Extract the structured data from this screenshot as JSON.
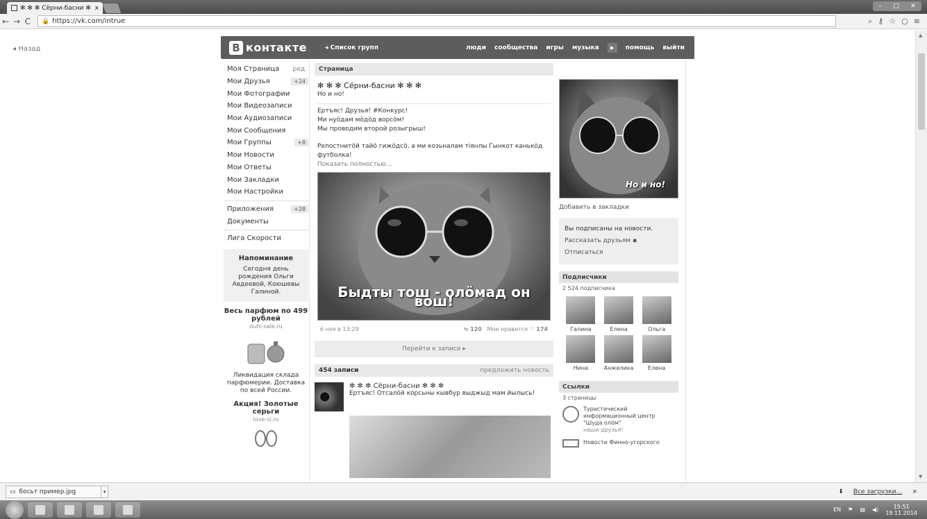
{
  "browser": {
    "tab_title": "✻ ✻ ✻ Сёрни-басни ✻",
    "tab_close": "x",
    "url": "https://vk.com/intrue"
  },
  "page": {
    "back": "Назад"
  },
  "vk": {
    "logo_letter": "В",
    "logo_text": "контакте",
    "group_list": "Список групп",
    "nav": [
      "люди",
      "сообщества",
      "игры",
      "музыка",
      "помощь",
      "выйти"
    ]
  },
  "menu": {
    "items": [
      {
        "label": "Моя Страница",
        "extra": "ред."
      },
      {
        "label": "Мои Друзья",
        "badge": "+24"
      },
      {
        "label": "Мои Фотографии"
      },
      {
        "label": "Мои Видеозаписи"
      },
      {
        "label": "Мои Аудиозаписи"
      },
      {
        "label": "Мои Сообщения"
      },
      {
        "label": "Мои Группы",
        "badge": "+8"
      },
      {
        "label": "Мои Новости"
      },
      {
        "label": "Мои Ответы"
      },
      {
        "label": "Мои Закладки"
      },
      {
        "label": "Мои Настройки"
      }
    ],
    "apps": {
      "label": "Приложения",
      "badge": "+28"
    },
    "docs": "Документы",
    "league": "Лига Скорости",
    "reminder_title": "Напоминание",
    "reminder_text": "Сегодня день рождения Ольги Авдеевой, Коюшевы Галиной.",
    "ad1_title": "Весь парфюм по 499 рублей",
    "ad1_url": "duhi-sale.ru",
    "ad1_text": "Ликвидация склада парфюмерии. Доставка по всей России.",
    "ad2_title": "Акция! Золотые серьги",
    "ad2_url": "love-sl.ru"
  },
  "main": {
    "page_bar": "Страница",
    "group_name": "✻ ✻ ✻ Сёрни-басни ✻ ✻ ✻",
    "status": "Но и но!",
    "post_lines": [
      "Ертъяс! Друзья! #Конкурс!",
      "Ми нуӧдам мӧдӧд ворсӧм!",
      "Мы проводим второй розыгрыш!",
      "Репостнитӧй тайӧ гижӧдсӧ, а ми козьналам тiянлы Гынкот канькӧд футболка!"
    ],
    "show_more": "Показать полностью…",
    "photo_caption": "Быдты тош - олӧмад он вош!",
    "date": "6 ноя в 13:29",
    "reposts": "120",
    "likes_label": "Мне нравится",
    "likes": "174",
    "go_to_post": "Перейти к записи",
    "wall_count": "454 записи",
    "suggest": "предложить новость",
    "wall_author": "✻ ✻ ✻ Сёрни-басни ✻ ✻ ✻",
    "wall_text": "Ертъяс! Отсалӧй корсьны кывбур выджыд мам йылысь!"
  },
  "right": {
    "cover_caption": "Но и но!",
    "bookmark": "Добавить в закладки",
    "subscribed": "Вы подписаны на новости.",
    "tell_friends": "Рассказать друзьям",
    "unsubscribe": "Отписаться",
    "subscribers_title": "Подписчики",
    "subscribers_count": "2 524 подписчика",
    "members": [
      "Галина",
      "Елена",
      "Ольга",
      "Нина",
      "Анжелика",
      "Елена"
    ],
    "links_title": "Ссылки",
    "links_count": "3 страницы",
    "link1": "Туристический информационный центр \"Шуда олӧм\"",
    "link1_sub": "наши друзья!",
    "link2": "Новости Финно-угорского"
  },
  "downloads": {
    "file": "босьт пример.jpg",
    "all": "Все загрузки…",
    "close": "×"
  },
  "taskbar": {
    "lang": "EN",
    "time": "15:51",
    "date": "19.11.2014"
  }
}
